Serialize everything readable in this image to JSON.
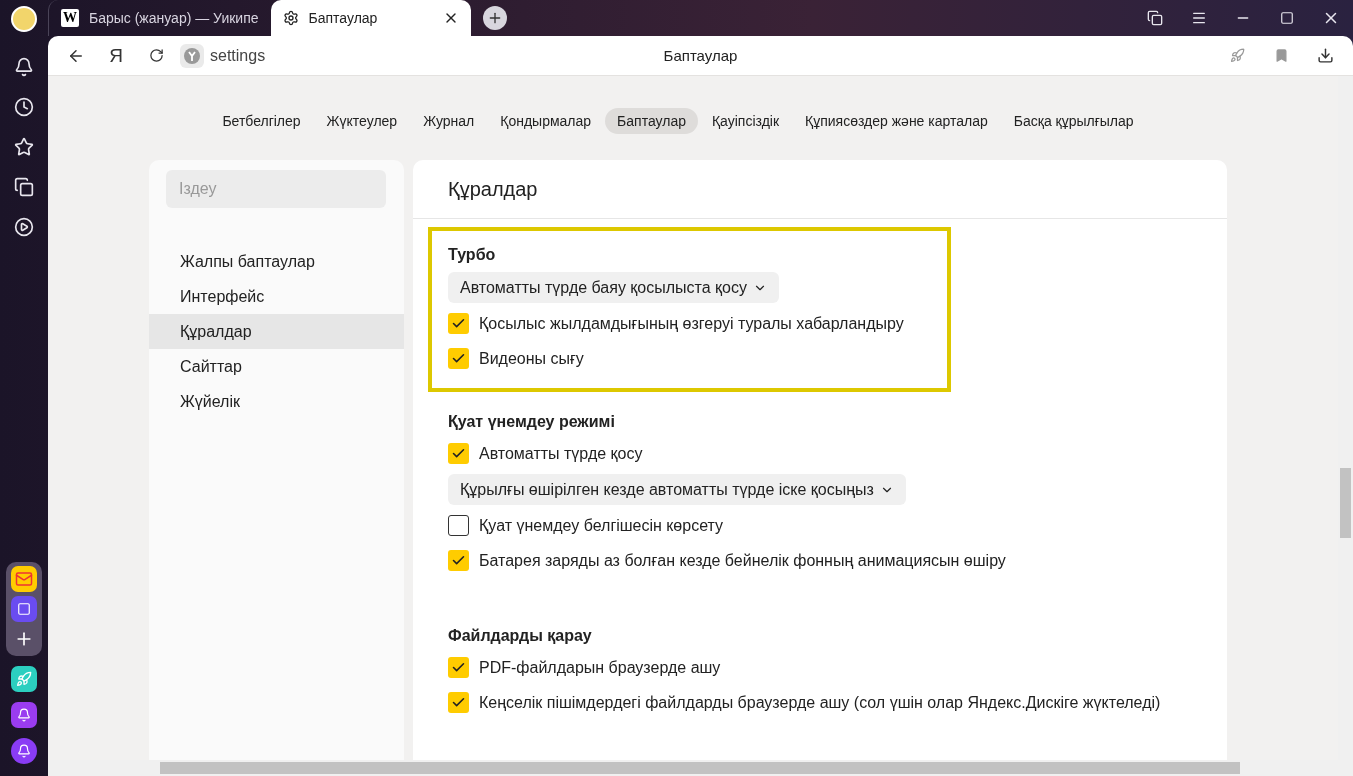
{
  "browser_tabs": [
    {
      "title": "Барыс (жануар) — Уикипе",
      "favicon": "W",
      "kind": "wiki",
      "selected": false
    },
    {
      "title": "Баптаулар",
      "kind": "settings",
      "selected": true
    }
  ],
  "toolbar": {
    "yandex_button": "Я",
    "address": "settings",
    "page_title": "Баптаулар"
  },
  "nav": [
    {
      "label": "Бетбелгілер",
      "selected": false
    },
    {
      "label": "Жүктеулер",
      "selected": false
    },
    {
      "label": "Журнал",
      "selected": false
    },
    {
      "label": "Қондырмалар",
      "selected": false
    },
    {
      "label": "Баптаулар",
      "selected": true
    },
    {
      "label": "Қауіпсіздік",
      "selected": false
    },
    {
      "label": "Құпиясөздер және карталар",
      "selected": false
    },
    {
      "label": "Басқа құрылғылар",
      "selected": false
    }
  ],
  "sidebar": {
    "search_placeholder": "Іздеу",
    "items": [
      {
        "label": "Жалпы баптаулар",
        "selected": false
      },
      {
        "label": "Интерфейс",
        "selected": false
      },
      {
        "label": "Құралдар",
        "selected": true
      },
      {
        "label": "Сайттар",
        "selected": false
      },
      {
        "label": "Жүйелік",
        "selected": false
      }
    ]
  },
  "panel": {
    "title": "Құралдар",
    "sections": [
      {
        "title": "Турбо",
        "highlighted": true,
        "items": [
          {
            "kind": "dropdown",
            "label": "Автоматты түрде баяу қосылыста қосу"
          },
          {
            "kind": "checkbox",
            "label": "Қосылыс жылдамдығының өзгеруі туралы хабарландыру",
            "checked": true
          },
          {
            "kind": "checkbox",
            "label": "Видеоны сығу",
            "checked": true
          }
        ]
      },
      {
        "title": "Қуат үнемдеу режимі",
        "highlighted": false,
        "items": [
          {
            "kind": "checkbox",
            "label": "Автоматты түрде қосу",
            "checked": true
          },
          {
            "kind": "dropdown",
            "label": "Құрылғы өшірілген кезде автоматты түрде іске қосыңыз"
          },
          {
            "kind": "checkbox",
            "label": "Қуат үнемдеу белгішесін көрсету",
            "checked": false
          },
          {
            "kind": "checkbox",
            "label": "Батарея заряды аз болған кезде бейнелік фонның анимациясын өшіру",
            "checked": true
          }
        ]
      },
      {
        "title": "Файлдарды қарау",
        "highlighted": false,
        "items": [
          {
            "kind": "checkbox",
            "label": "PDF-файлдарын браузерде ашу",
            "checked": true
          },
          {
            "kind": "checkbox",
            "label": "Кеңселік пішімдердегі файлдарды браузерде ашу (сол үшін олар Яндекс.Дискіге жүктеледі)",
            "checked": true
          }
        ]
      }
    ]
  }
}
